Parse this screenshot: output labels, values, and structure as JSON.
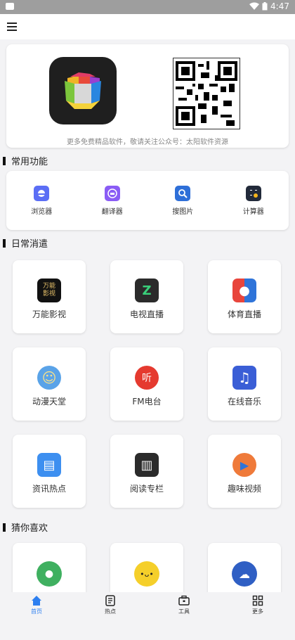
{
  "status_bar": {
    "time": "4:47"
  },
  "banner": {
    "caption": "更多免费精品软件，敬请关注公众号：太阳软件资源"
  },
  "sections": {
    "common": "常用功能",
    "leisure": "日常消遣",
    "recommend": "猜你喜欢"
  },
  "tools": [
    {
      "label": "浏览器",
      "icon": "browser-icon",
      "color": "#5b6ef5"
    },
    {
      "label": "翻译器",
      "icon": "translator-icon",
      "color": "#8a5cf5"
    },
    {
      "label": "搜图片",
      "icon": "image-search-icon",
      "color": "#2e6fd8"
    },
    {
      "label": "计算器",
      "icon": "calculator-icon",
      "color": "#222a3a"
    }
  ],
  "leisure": [
    {
      "label": "万能影视",
      "icon": "film-icon",
      "glyph": "万能\n影视",
      "color": "#111111"
    },
    {
      "label": "电视直播",
      "icon": "tv-icon",
      "glyph": "Z",
      "color": "#2b2b2b"
    },
    {
      "label": "体育直播",
      "icon": "basketball-icon",
      "glyph": "●",
      "color": "#e8453c"
    },
    {
      "label": "动漫天堂",
      "icon": "anime-icon",
      "glyph": "☺",
      "color": "#5aa3e8"
    },
    {
      "label": "FM电台",
      "icon": "radio-icon",
      "glyph": "听",
      "color": "#e53a2f"
    },
    {
      "label": "在线音乐",
      "icon": "music-icon",
      "glyph": "♫",
      "color": "#3a5ed6"
    },
    {
      "label": "资讯热点",
      "icon": "news-icon",
      "glyph": "▤",
      "color": "#3d8ff0"
    },
    {
      "label": "阅读专栏",
      "icon": "book-icon",
      "glyph": "▥",
      "color": "#2b2b2b"
    },
    {
      "label": "趣味视频",
      "icon": "play-icon",
      "glyph": "▶",
      "color": "#ef7a3a"
    }
  ],
  "favorites": [
    {
      "icon": "chat-icon",
      "glyph": "●",
      "color": "#3fb060"
    },
    {
      "icon": "emoji-icon",
      "glyph": "•ᴗ•",
      "color": "#f5cf2a"
    },
    {
      "icon": "cloud-icon",
      "glyph": "☁",
      "color": "#2f5fc4"
    }
  ],
  "tabs": [
    {
      "label": "首页",
      "icon": "home-icon",
      "active": true
    },
    {
      "label": "热点",
      "icon": "hot-icon",
      "active": false
    },
    {
      "label": "工具",
      "icon": "toolbox-icon",
      "active": false
    },
    {
      "label": "更多",
      "icon": "grid-icon",
      "active": false
    }
  ]
}
